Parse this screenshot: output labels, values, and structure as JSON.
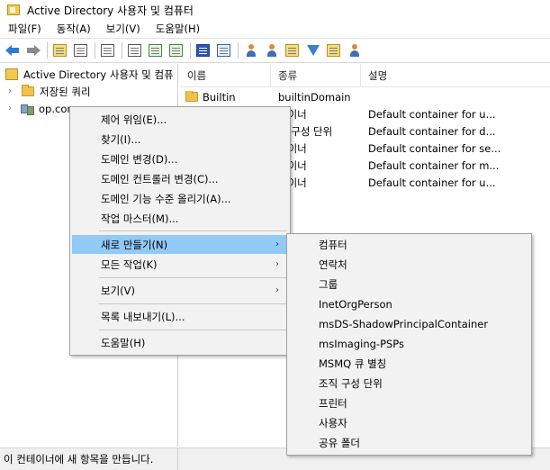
{
  "window": {
    "title": "Active Directory 사용자 및 컴퓨터",
    "icon": "folder-icon"
  },
  "menubar": [
    {
      "label": "파일(F)"
    },
    {
      "label": "동작(A)"
    },
    {
      "label": "보기(V)"
    },
    {
      "label": "도움말(H)"
    }
  ],
  "toolbar": {
    "buttons": [
      "back-icon",
      "forward-icon",
      "up-icon",
      "tree-icon",
      "copy-icon",
      "properties-icon",
      "refresh-icon",
      "export-icon",
      "help-icon",
      "view-icon",
      "users-icon",
      "group-icon",
      "ou-icon",
      "filter-icon",
      "find-icon",
      "delegate-icon"
    ]
  },
  "tree": {
    "root": "Active Directory 사용자 및 컴퓨",
    "items": [
      {
        "label": "저장된 쿼리",
        "icon": "folder-icon"
      },
      {
        "label": "op.com",
        "icon": "domain-icon"
      }
    ]
  },
  "list": {
    "columns": [
      "이름",
      "종류",
      "설명"
    ],
    "rows": [
      {
        "name": "Builtin",
        "type": "builtinDomain",
        "desc": ""
      },
      {
        "name": "",
        "type": "테이너",
        "desc": "Default container for u..."
      },
      {
        "name": "",
        "type": "직 구성 단위",
        "desc": "Default container for d..."
      },
      {
        "name": "",
        "type": "테이너",
        "desc": "Default container for se..."
      },
      {
        "name": "",
        "type": "테이너",
        "desc": "Default container for m..."
      },
      {
        "name": "",
        "type": "테이너",
        "desc": "Default container for u..."
      }
    ]
  },
  "context_menu": {
    "items": [
      {
        "label": "제어 위임(E)..."
      },
      {
        "label": "찾기(I)..."
      },
      {
        "label": "도메인 변경(D)..."
      },
      {
        "label": "도메인 컨트롤러 변경(C)..."
      },
      {
        "label": "도메인 기능 수준 올리기(A)..."
      },
      {
        "label": "작업 마스터(M)..."
      },
      {
        "label": "새로 만들기(N)",
        "submenu": true,
        "highlighted": true
      },
      {
        "label": "모든 작업(K)",
        "submenu": true
      },
      {
        "label": "보기(V)",
        "submenu": true
      },
      {
        "label": "목록 내보내기(L)..."
      },
      {
        "label": "도움말(H)"
      }
    ],
    "highlight_color": "#91c9f7"
  },
  "submenu": {
    "items": [
      {
        "label": "컴퓨터"
      },
      {
        "label": "연락처"
      },
      {
        "label": "그룹"
      },
      {
        "label": "InetOrgPerson"
      },
      {
        "label": "msDS-ShadowPrincipalContainer"
      },
      {
        "label": "msImaging-PSPs"
      },
      {
        "label": "MSMQ 큐 별칭"
      },
      {
        "label": "조직 구성 단위"
      },
      {
        "label": "프린터"
      },
      {
        "label": "사용자"
      },
      {
        "label": "공유 폴더"
      }
    ]
  },
  "status": {
    "text": "이 컨테이너에 새 항목을 만듭니다."
  }
}
